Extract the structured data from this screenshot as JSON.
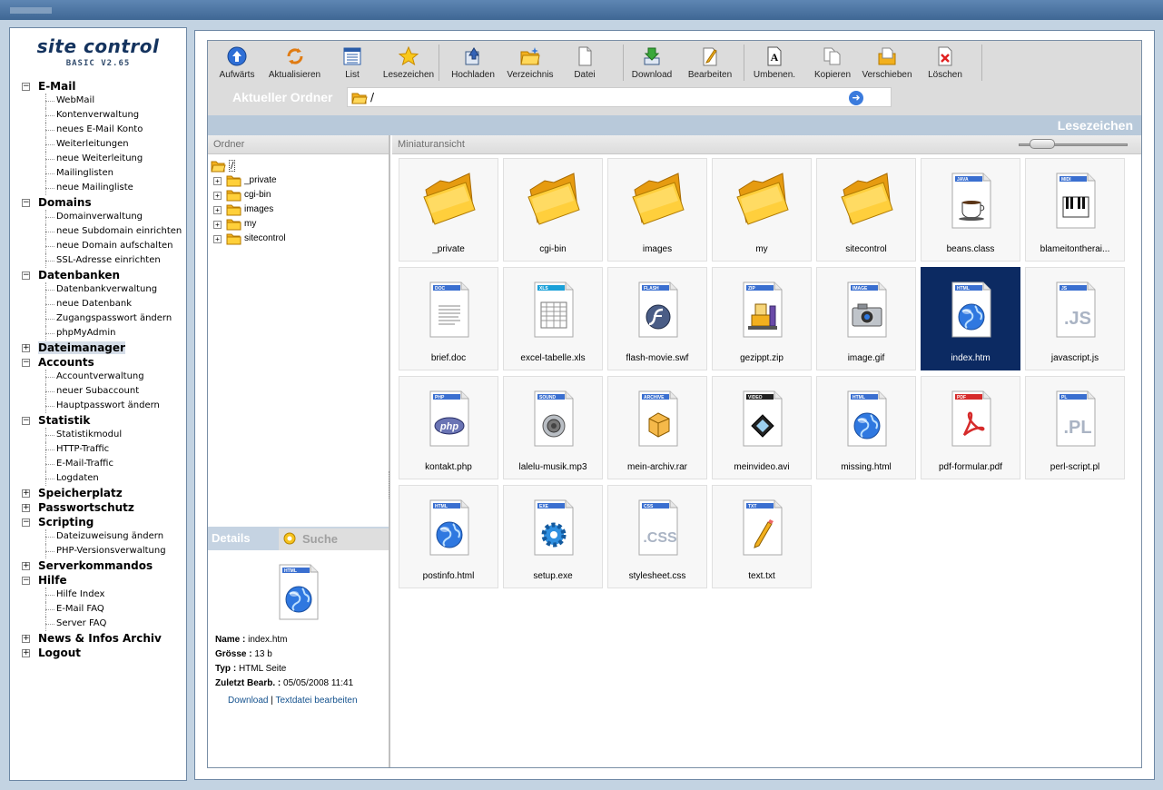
{
  "brand": {
    "title": "site control",
    "version": "BASIC V2.65"
  },
  "sidebar": {
    "categories": [
      {
        "label": "E-Mail",
        "expanded": true,
        "items": [
          "WebMail",
          "Kontenverwaltung",
          "neues E-Mail Konto",
          "Weiterleitungen",
          "neue Weiterleitung",
          "Mailinglisten",
          "neue Mailingliste"
        ]
      },
      {
        "label": "Domains",
        "expanded": true,
        "items": [
          "Domainverwaltung",
          "neue Subdomain einrichten",
          "neue Domain aufschalten",
          "SSL-Adresse einrichten"
        ]
      },
      {
        "label": "Datenbanken",
        "expanded": true,
        "items": [
          "Datenbankverwaltung",
          "neue Datenbank",
          "Zugangspasswort ändern",
          "phpMyAdmin"
        ]
      },
      {
        "label": "Dateimanager",
        "expanded": false,
        "active": true,
        "items": []
      },
      {
        "label": "Accounts",
        "expanded": true,
        "items": [
          "Accountverwaltung",
          "neuer Subaccount",
          "Hauptpasswort ändern"
        ]
      },
      {
        "label": "Statistik",
        "expanded": true,
        "items": [
          "Statistikmodul",
          "HTTP-Traffic",
          "E-Mail-Traffic",
          "Logdaten"
        ]
      },
      {
        "label": "Speicherplatz",
        "expanded": false,
        "items": []
      },
      {
        "label": "Passwortschutz",
        "expanded": false,
        "items": []
      },
      {
        "label": "Scripting",
        "expanded": true,
        "items": [
          "Dateizuweisung ändern",
          "PHP-Versionsverwaltung"
        ]
      },
      {
        "label": "Serverkommandos",
        "expanded": false,
        "items": []
      },
      {
        "label": "Hilfe",
        "expanded": true,
        "items": [
          "Hilfe Index",
          "E-Mail FAQ",
          "Server FAQ"
        ]
      },
      {
        "label": "News & Infos Archiv",
        "expanded": false,
        "items": []
      },
      {
        "label": "Logout",
        "expanded": false,
        "items": []
      }
    ]
  },
  "toolbar": {
    "buttons": [
      {
        "id": "up",
        "label": "Aufwärts",
        "icon": "arrow-up-circle-icon"
      },
      {
        "id": "refresh",
        "label": "Aktualisieren",
        "icon": "refresh-icon"
      },
      {
        "id": "list",
        "label": "List",
        "icon": "list-view-icon"
      },
      {
        "id": "bookmarks",
        "label": "Lesezeichen",
        "icon": "star-icon"
      },
      {
        "id": "upload",
        "label": "Hochladen",
        "icon": "upload-icon"
      },
      {
        "id": "newdir",
        "label": "Verzeichnis",
        "icon": "new-folder-icon"
      },
      {
        "id": "newfile",
        "label": "Datei",
        "icon": "new-file-icon"
      },
      {
        "id": "download",
        "label": "Download",
        "icon": "download-icon"
      },
      {
        "id": "edit",
        "label": "Bearbeiten",
        "icon": "edit-icon"
      },
      {
        "id": "rename",
        "label": "Umbenen.",
        "icon": "rename-icon"
      },
      {
        "id": "copy",
        "label": "Kopieren",
        "icon": "copy-icon"
      },
      {
        "id": "move",
        "label": "Verschieben",
        "icon": "move-icon"
      },
      {
        "id": "delete",
        "label": "Löschen",
        "icon": "delete-icon"
      }
    ],
    "current_folder_label": "Aktueller Ordner",
    "current_folder": "/"
  },
  "bookmark_bar": {
    "title": "Lesezeichen"
  },
  "left_pane": {
    "header": "Ordner",
    "root": "/",
    "folders": [
      "_private",
      "cgi-bin",
      "images",
      "my",
      "sitecontrol"
    ]
  },
  "details": {
    "tab_details": "Details",
    "tab_search": "Suche",
    "icon_tag": "HTML",
    "name_label": "Name :",
    "name_value": "index.htm",
    "size_label": "Grösse :",
    "size_value": "13 b",
    "type_label": "Typ :",
    "type_value": "HTML Seite",
    "modified_label": "Zuletzt Bearb. :",
    "modified_value": "05/05/2008 11:41",
    "link_download": "Download",
    "link_separator": "|",
    "link_edit": "Textdatei bearbeiten"
  },
  "right_pane": {
    "header": "Miniaturansicht",
    "files": [
      {
        "name": "_private",
        "kind": "folder"
      },
      {
        "name": "cgi-bin",
        "kind": "folder"
      },
      {
        "name": "images",
        "kind": "folder"
      },
      {
        "name": "my",
        "kind": "folder"
      },
      {
        "name": "sitecontrol",
        "kind": "folder"
      },
      {
        "name": "beans.class",
        "kind": "file",
        "tag": "JAVA",
        "glyph": "coffee-cup-icon",
        "color": "#3a6fd0"
      },
      {
        "name": "blameitontherai...",
        "kind": "file",
        "tag": "MIDI",
        "glyph": "piano-keys-icon",
        "color": "#3a6fd0"
      },
      {
        "name": "brief.doc",
        "kind": "file",
        "tag": "DOC",
        "glyph": "document-text-icon",
        "color": "#3a6fd0"
      },
      {
        "name": "excel-tabelle.xls",
        "kind": "file",
        "tag": "XLS",
        "glyph": "spreadsheet-icon",
        "color": "#1aa0d8"
      },
      {
        "name": "flash-movie.swf",
        "kind": "file",
        "tag": "FLASH",
        "glyph": "flash-icon",
        "color": "#3a6fd0"
      },
      {
        "name": "gezippt.zip",
        "kind": "file",
        "tag": "ZIP",
        "glyph": "zip-vise-icon",
        "color": "#3a6fd0"
      },
      {
        "name": "image.gif",
        "kind": "file",
        "tag": "IMAGE",
        "glyph": "camera-icon",
        "color": "#3a6fd0"
      },
      {
        "name": "index.htm",
        "kind": "file",
        "tag": "HTML",
        "glyph": "globe-icon",
        "color": "#3a6fd0",
        "selected": true
      },
      {
        "name": "javascript.js",
        "kind": "file",
        "tag": "JS",
        "glyph": "js-text-icon",
        "color": "#3a6fd0"
      },
      {
        "name": "kontakt.php",
        "kind": "file",
        "tag": "PHP",
        "glyph": "php-logo-icon",
        "color": "#3a6fd0"
      },
      {
        "name": "lalelu-musik.mp3",
        "kind": "file",
        "tag": "SOUND",
        "glyph": "speaker-icon",
        "color": "#3a6fd0"
      },
      {
        "name": "mein-archiv.rar",
        "kind": "file",
        "tag": "ARCHIVE",
        "glyph": "box-icon",
        "color": "#3a6fd0"
      },
      {
        "name": "meinvideo.avi",
        "kind": "file",
        "tag": "VIDEO",
        "glyph": "film-icon",
        "color": "#222222"
      },
      {
        "name": "missing.html",
        "kind": "file",
        "tag": "HTML",
        "glyph": "globe-icon",
        "color": "#3a6fd0"
      },
      {
        "name": "pdf-formular.pdf",
        "kind": "file",
        "tag": "PDF",
        "glyph": "pdf-icon",
        "color": "#d62b2b"
      },
      {
        "name": "perl-script.pl",
        "kind": "file",
        "tag": "PL",
        "glyph": "pl-text-icon",
        "color": "#3a6fd0"
      },
      {
        "name": "postinfo.html",
        "kind": "file",
        "tag": "HTML",
        "glyph": "globe-icon",
        "color": "#3a6fd0"
      },
      {
        "name": "setup.exe",
        "kind": "file",
        "tag": "EXE",
        "glyph": "gear-icon",
        "color": "#3a6fd0"
      },
      {
        "name": "stylesheet.css",
        "kind": "file",
        "tag": "CSS",
        "glyph": "css-text-icon",
        "color": "#3a6fd0"
      },
      {
        "name": "text.txt",
        "kind": "file",
        "tag": "TXT",
        "glyph": "pencil-icon",
        "color": "#3a6fd0"
      }
    ]
  }
}
